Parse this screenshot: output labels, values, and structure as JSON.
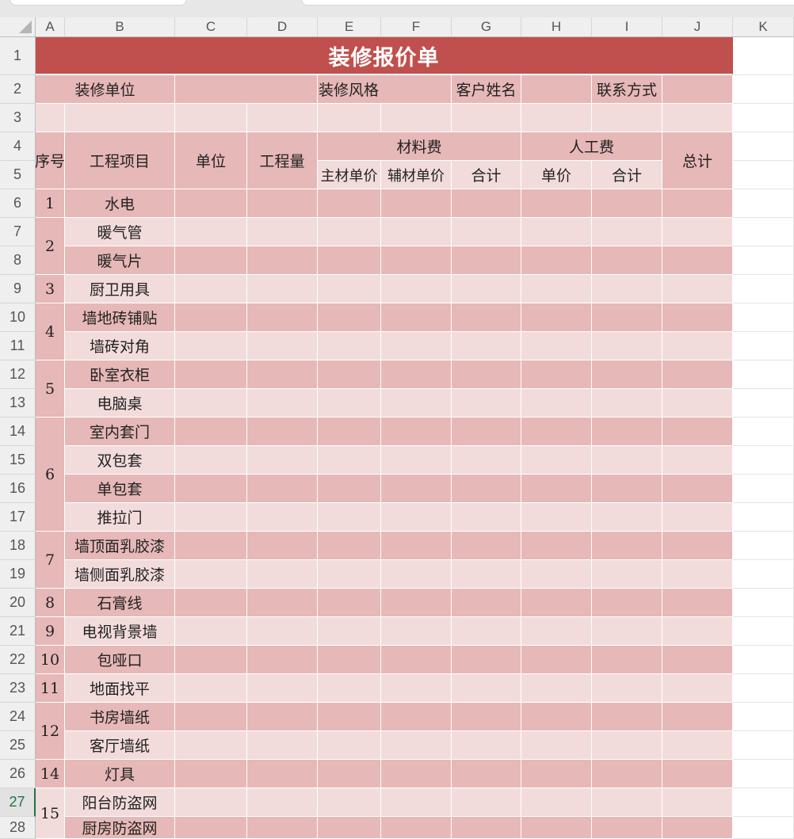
{
  "columns": [
    "A",
    "B",
    "C",
    "D",
    "E",
    "F",
    "G",
    "H",
    "I",
    "J",
    "K"
  ],
  "rows": [
    "1",
    "2",
    "3",
    "4",
    "5",
    "6",
    "7",
    "8",
    "9",
    "10",
    "11",
    "12",
    "13",
    "14",
    "15",
    "16",
    "17",
    "18",
    "19",
    "20",
    "21",
    "22",
    "23",
    "24",
    "25",
    "26",
    "27",
    "28"
  ],
  "active_row": "27",
  "sheet": {
    "title": "装修报价单",
    "info": {
      "unit_label": "装修单位",
      "style_label": "装修风格",
      "customer_label": "客户姓名",
      "contact_label": "联系方式"
    },
    "headers": {
      "seq": "序号",
      "item": "工程项目",
      "unit": "单位",
      "qty": "工程量",
      "material": "材料费",
      "labor": "人工费",
      "total": "总计",
      "main_price": "主材单价",
      "aux_price": "辅材单价",
      "mat_sum": "合计",
      "labor_price": "单价",
      "labor_sum": "合计"
    },
    "groups": [
      {
        "seq": "1",
        "items": [
          "水电"
        ]
      },
      {
        "seq": "2",
        "items": [
          "暖气管",
          "暖气片"
        ]
      },
      {
        "seq": "3",
        "items": [
          "厨卫用具"
        ]
      },
      {
        "seq": "4",
        "items": [
          "墙地砖铺贴",
          "墙砖对角"
        ]
      },
      {
        "seq": "5",
        "items": [
          "卧室衣柜",
          "电脑桌"
        ]
      },
      {
        "seq": "6",
        "items": [
          "室内套门",
          "双包套",
          "单包套",
          "推拉门"
        ]
      },
      {
        "seq": "7",
        "items": [
          "墙顶面乳胶漆",
          "墙侧面乳胶漆"
        ]
      },
      {
        "seq": "8",
        "items": [
          "石膏线"
        ]
      },
      {
        "seq": "9",
        "items": [
          "电视背景墙"
        ]
      },
      {
        "seq": "10",
        "items": [
          "包哑口"
        ]
      },
      {
        "seq": "11",
        "items": [
          "地面找平"
        ]
      },
      {
        "seq": "12",
        "items": [
          "书房墙纸",
          "客厅墙纸"
        ]
      },
      {
        "seq": "14",
        "items": [
          "灯具"
        ]
      },
      {
        "seq": "15",
        "items": [
          "阳台防盗网",
          "厨房防盗网"
        ]
      }
    ]
  },
  "colors": {
    "title_bg": "#c0504d",
    "band_dark": "#e6b8b7",
    "band_light": "#f2dcdb",
    "header_bg": "#efefef",
    "active_row_color": "#217346"
  }
}
